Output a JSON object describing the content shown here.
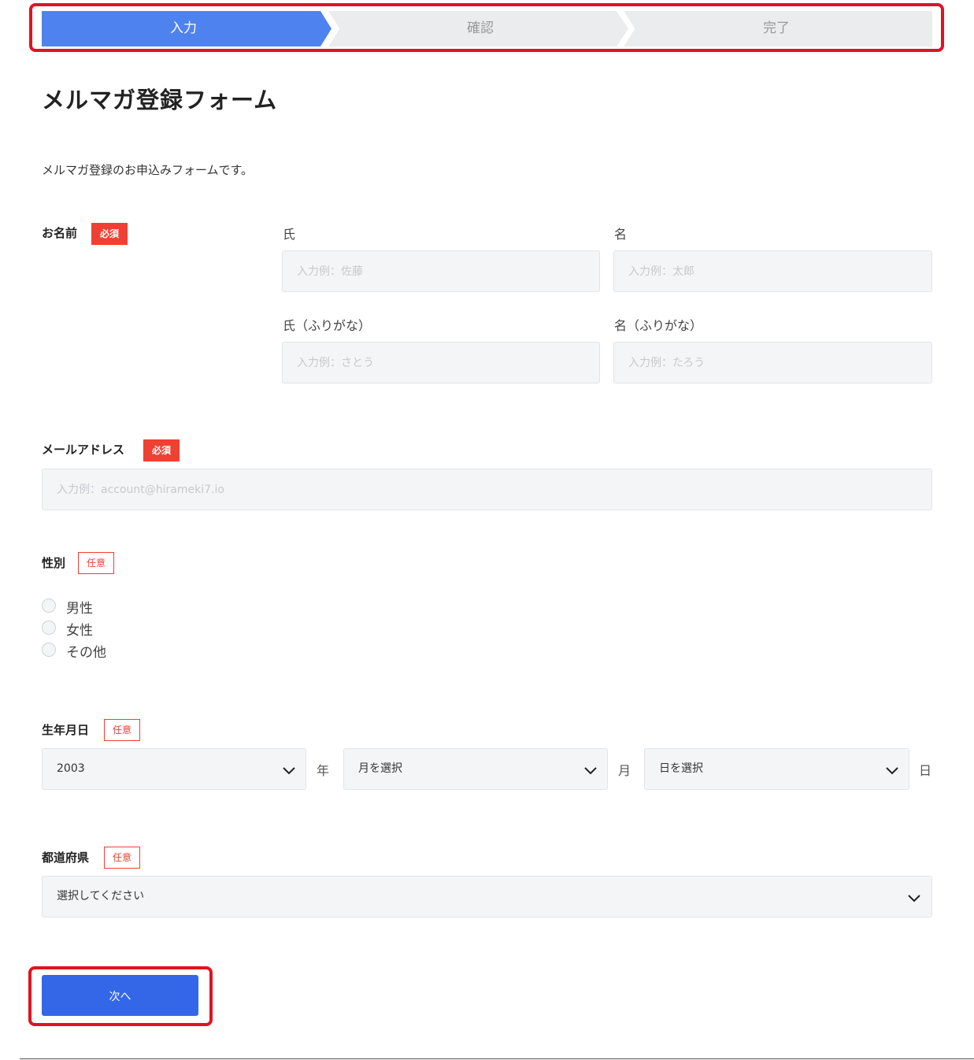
{
  "steps": [
    {
      "label": "入力",
      "active": true
    },
    {
      "label": "確認",
      "active": false
    },
    {
      "label": "完了",
      "active": false
    }
  ],
  "colors": {
    "accent": "#3467e8",
    "step_active": "#4e82ee",
    "step_inactive": "#ebecee",
    "required_badge": "#ef4034",
    "highlight_frame": "#e0141e"
  },
  "title": "メルマガ登録フォーム",
  "description": "メルマガ登録のお申込みフォームです。",
  "badges": {
    "required": "必須",
    "optional": "任意"
  },
  "name_field": {
    "label": "お名前",
    "last_name": {
      "label": "氏",
      "placeholder": "入力例：佐藤"
    },
    "first_name": {
      "label": "名",
      "placeholder": "入力例：太郎"
    },
    "last_name_kana": {
      "label": "氏（ふりがな）",
      "placeholder": "入力例：さとう"
    },
    "first_name_kana": {
      "label": "名（ふりがな）",
      "placeholder": "入力例：たろう"
    }
  },
  "email_field": {
    "label": "メールアドレス",
    "placeholder": "入力例：account@hirameki7.io"
  },
  "gender_field": {
    "label": "性別",
    "options": [
      "男性",
      "女性",
      "その他"
    ]
  },
  "birthdate_field": {
    "label": "生年月日",
    "year": {
      "value": "2003",
      "unit": "年"
    },
    "month": {
      "value": "月を選択",
      "unit": "月"
    },
    "day": {
      "value": "日を選択",
      "unit": "日"
    }
  },
  "prefecture_field": {
    "label": "都道府県",
    "value": "選択してください"
  },
  "next_button": {
    "label": "次へ"
  }
}
